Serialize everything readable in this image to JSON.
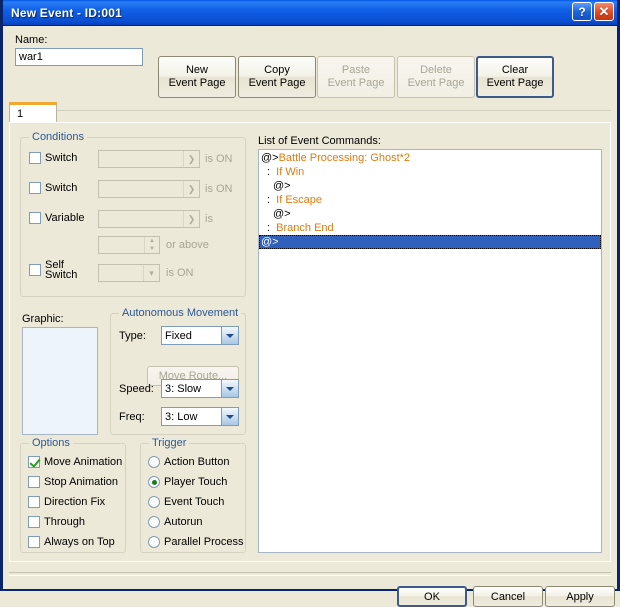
{
  "window": {
    "title": "New Event - ID:001",
    "help_button": "?",
    "close_button": "✕"
  },
  "toolbar": {
    "name_label": "Name:",
    "name_value": "war1",
    "name_placeholder": "",
    "buttons": [
      {
        "line1": "New",
        "line2": "Event Page",
        "disabled": false
      },
      {
        "line1": "Copy",
        "line2": "Event Page",
        "disabled": false
      },
      {
        "line1": "Paste",
        "line2": "Event Page",
        "disabled": true
      },
      {
        "line1": "Delete",
        "line2": "Event Page",
        "disabled": true
      },
      {
        "line1": "Clear",
        "line2": "Event Page",
        "disabled": false
      }
    ]
  },
  "tabs": [
    {
      "label": "1",
      "selected": true
    }
  ],
  "conditions": {
    "title": "Conditions",
    "rows": [
      {
        "label": "Switch",
        "checked": false,
        "value": "",
        "suffix": "is ON"
      },
      {
        "label": "Switch",
        "checked": false,
        "value": "",
        "suffix": "is ON"
      },
      {
        "label": "Variable",
        "checked": false,
        "value": "",
        "suffix": "is"
      },
      {
        "label": "",
        "checked": null,
        "value": "",
        "suffix": "or above"
      },
      {
        "label": "Self Switch",
        "checked": false,
        "value": "",
        "suffix": "is ON"
      }
    ]
  },
  "graphic": {
    "label": "Graphic:"
  },
  "autonomous_movement": {
    "title": "Autonomous Movement",
    "type_label": "Type:",
    "type_value": "Fixed",
    "move_route_label": "Move Route...",
    "speed_label": "Speed:",
    "speed_value": "3: Slow",
    "freq_label": "Freq:",
    "freq_value": "3: Low"
  },
  "options": {
    "title": "Options",
    "items": [
      {
        "label": "Move Animation",
        "checked": true
      },
      {
        "label": "Stop Animation",
        "checked": false
      },
      {
        "label": "Direction Fix",
        "checked": false
      },
      {
        "label": "Through",
        "checked": false
      },
      {
        "label": "Always on Top",
        "checked": false
      }
    ]
  },
  "trigger": {
    "title": "Trigger",
    "items": [
      {
        "label": "Action Button",
        "selected": false
      },
      {
        "label": "Player Touch",
        "selected": true
      },
      {
        "label": "Event Touch",
        "selected": false
      },
      {
        "label": "Autorun",
        "selected": false
      },
      {
        "label": "Parallel Process",
        "selected": false
      }
    ]
  },
  "command_list": {
    "label": "List of Event Commands:",
    "rows": [
      {
        "prefix": "@>",
        "text": "Battle Processing: Ghost*2",
        "indent": 0,
        "selected": false
      },
      {
        "prefix": ":",
        "text": "  If Win",
        "indent": 1,
        "selected": false
      },
      {
        "prefix": "@>",
        "text": "",
        "indent": 2,
        "selected": false
      },
      {
        "prefix": ":",
        "text": "  If Escape",
        "indent": 1,
        "selected": false
      },
      {
        "prefix": "@>",
        "text": "",
        "indent": 2,
        "selected": false
      },
      {
        "prefix": ":",
        "text": "  Branch End",
        "indent": 1,
        "selected": false
      },
      {
        "prefix": "@>",
        "text": "",
        "indent": 0,
        "selected": true
      }
    ]
  },
  "footer": {
    "ok_label": "OK",
    "cancel_label": "Cancel",
    "apply_label": "Apply"
  },
  "colors": {
    "titlebar_blue": "#0a50d8",
    "command_orange": "#e07b10",
    "selection_blue": "#2f60bb",
    "group_title_blue": "#2b5797",
    "check_green": "#22a022"
  }
}
